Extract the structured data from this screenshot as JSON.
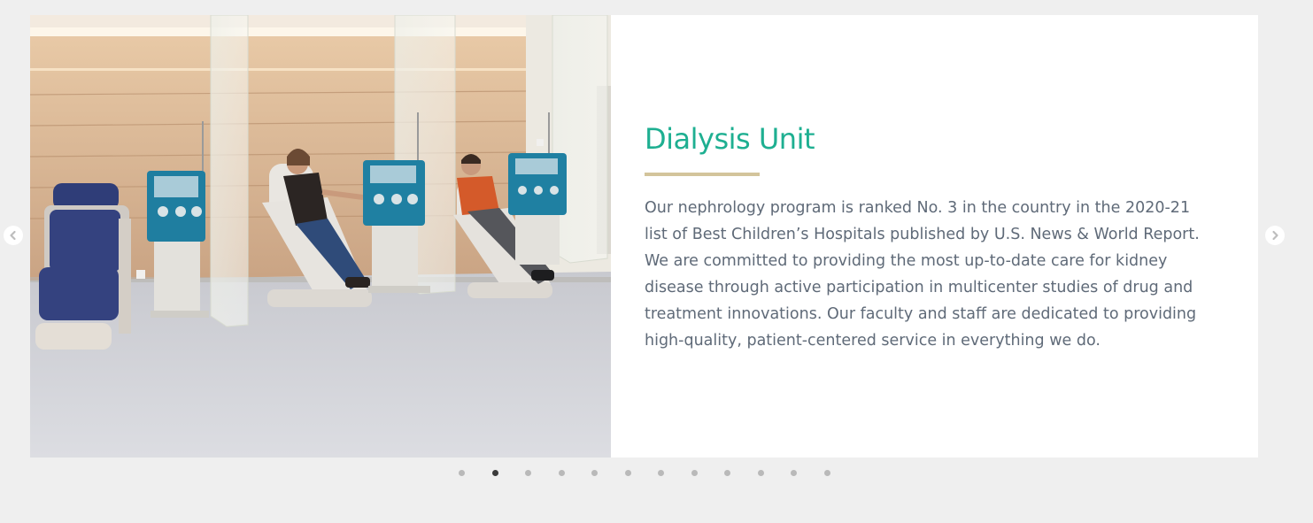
{
  "slide": {
    "title": "Dialysis Unit",
    "body": "Our nephrology program is ranked No. 3 in the country in the 2020-21 list of Best Children’s Hospitals published by U.S. News & World Report. We are committed to providing the most up-to-date care for kidney disease through active participation in multicenter studies of drug and treatment innovations. Our faculty and staff are dedicated to providing high-quality, patient-centered service in everything we do.",
    "image_alt": "Patients receiving dialysis in reclining chairs beside dialysis machines"
  },
  "carousel": {
    "prev_icon": "chevron-left-icon",
    "next_icon": "chevron-right-icon",
    "dot_count": 12,
    "active_index": 1
  },
  "colors": {
    "page_background": "#efefef",
    "title": "#1eaf91",
    "title_rule": "#d3c49b",
    "body_text": "#5f6a78",
    "dot_inactive": "#b9b9b9",
    "dot_active": "#3b3b3b"
  }
}
